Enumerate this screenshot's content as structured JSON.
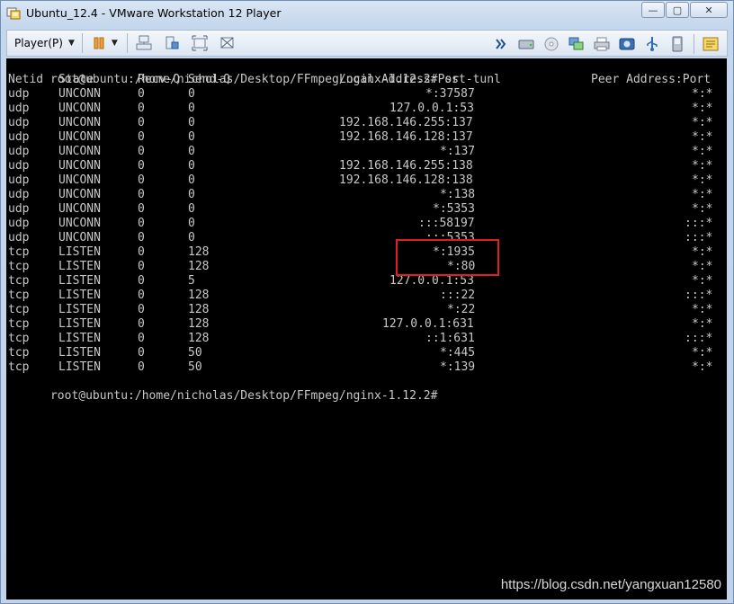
{
  "window": {
    "title": "Ubuntu_12.4 - VMware Workstation 12 Player",
    "minimize_glyph": "—",
    "maximize_glyph": "▢",
    "close_glyph": "✕"
  },
  "toolbar": {
    "player_menu_label": "Player(P)",
    "player_menu_arrow": "▼",
    "pause_arrow": "▼",
    "icons_left": [
      "pause-icon",
      "send-ctrl-alt-del-icon",
      "removable-devices-icon",
      "full-screen-icon",
      "unity-icon"
    ],
    "icons_right": [
      "chevron-right-icon",
      "hard-disk-icon",
      "cd-dvd-icon",
      "network-adapter-icon",
      "printer-icon",
      "sound-card-icon",
      "usb-icon",
      "display-icon",
      "message-log-icon"
    ]
  },
  "terminal": {
    "prompt": "root@ubuntu:/home/nicholas/Desktop/FFmpeg/nginx-1.12.2#",
    "command": " ss -tunl",
    "headers": {
      "netid": "Netid",
      "state": "State",
      "recvq": "Recv-Q",
      "sendq": "Send-Q",
      "local": "Local Address:Port",
      "peer": "Peer Address:Port"
    },
    "rows": [
      {
        "netid": "udp",
        "state": "UNCONN",
        "recvq": "0",
        "sendq": "0",
        "local": "*:37587",
        "peer": "*:*"
      },
      {
        "netid": "udp",
        "state": "UNCONN",
        "recvq": "0",
        "sendq": "0",
        "local": "127.0.0.1:53",
        "peer": "*:*"
      },
      {
        "netid": "udp",
        "state": "UNCONN",
        "recvq": "0",
        "sendq": "0",
        "local": "192.168.146.255:137",
        "peer": "*:*"
      },
      {
        "netid": "udp",
        "state": "UNCONN",
        "recvq": "0",
        "sendq": "0",
        "local": "192.168.146.128:137",
        "peer": "*:*"
      },
      {
        "netid": "udp",
        "state": "UNCONN",
        "recvq": "0",
        "sendq": "0",
        "local": "*:137",
        "peer": "*:*"
      },
      {
        "netid": "udp",
        "state": "UNCONN",
        "recvq": "0",
        "sendq": "0",
        "local": "192.168.146.255:138",
        "peer": "*:*"
      },
      {
        "netid": "udp",
        "state": "UNCONN",
        "recvq": "0",
        "sendq": "0",
        "local": "192.168.146.128:138",
        "peer": "*:*"
      },
      {
        "netid": "udp",
        "state": "UNCONN",
        "recvq": "0",
        "sendq": "0",
        "local": "*:138",
        "peer": "*:*"
      },
      {
        "netid": "udp",
        "state": "UNCONN",
        "recvq": "0",
        "sendq": "0",
        "local": "*:5353",
        "peer": "*:*"
      },
      {
        "netid": "udp",
        "state": "UNCONN",
        "recvq": "0",
        "sendq": "0",
        "local": ":::58197",
        "peer": ":::*"
      },
      {
        "netid": "udp",
        "state": "UNCONN",
        "recvq": "0",
        "sendq": "0",
        "local": ":::5353",
        "peer": ":::*"
      },
      {
        "netid": "tcp",
        "state": "LISTEN",
        "recvq": "0",
        "sendq": "128",
        "local": "*:1935",
        "peer": "*:*"
      },
      {
        "netid": "tcp",
        "state": "LISTEN",
        "recvq": "0",
        "sendq": "128",
        "local": "*:80",
        "peer": "*:*"
      },
      {
        "netid": "tcp",
        "state": "LISTEN",
        "recvq": "0",
        "sendq": "5",
        "local": "127.0.0.1:53",
        "peer": "*:*"
      },
      {
        "netid": "tcp",
        "state": "LISTEN",
        "recvq": "0",
        "sendq": "128",
        "local": ":::22",
        "peer": ":::*"
      },
      {
        "netid": "tcp",
        "state": "LISTEN",
        "recvq": "0",
        "sendq": "128",
        "local": "*:22",
        "peer": "*:*"
      },
      {
        "netid": "tcp",
        "state": "LISTEN",
        "recvq": "0",
        "sendq": "128",
        "local": "127.0.0.1:631",
        "peer": "*:*"
      },
      {
        "netid": "tcp",
        "state": "LISTEN",
        "recvq": "0",
        "sendq": "128",
        "local": "::1:631",
        "peer": ":::*"
      },
      {
        "netid": "tcp",
        "state": "LISTEN",
        "recvq": "0",
        "sendq": "50",
        "local": "*:445",
        "peer": "*:*"
      },
      {
        "netid": "tcp",
        "state": "LISTEN",
        "recvq": "0",
        "sendq": "50",
        "local": "*:139",
        "peer": "*:*"
      }
    ],
    "final_prompt": "root@ubuntu:/home/nicholas/Desktop/FFmpeg/nginx-1.12.2#"
  },
  "annotation": {
    "highlight_color": "#e02020"
  },
  "watermark": "https://blog.csdn.net/yangxuan12580",
  "colors": {
    "terminal_bg": "#000000",
    "terminal_fg": "#c8c8c8",
    "chrome_bg": "#c5d7ec"
  }
}
